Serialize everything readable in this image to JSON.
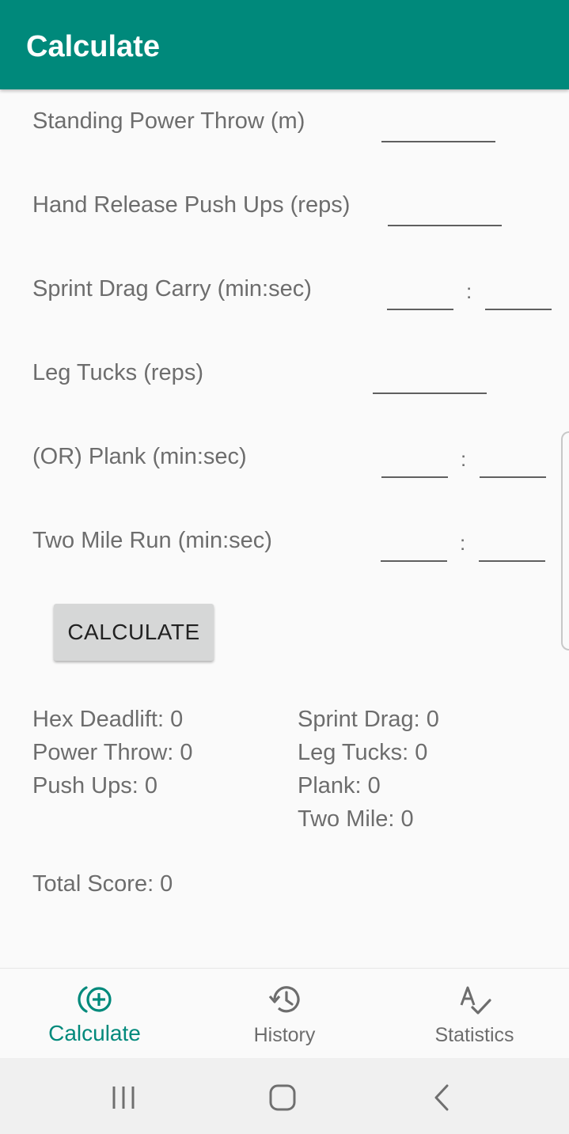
{
  "appbar": {
    "title": "Calculate"
  },
  "fields": [
    {
      "label": "Standing Power Throw (m)",
      "inputs": [
        ""
      ]
    },
    {
      "label": "Hand Release Push Ups (reps)",
      "inputs": [
        ""
      ]
    },
    {
      "label": "Sprint Drag Carry (min:sec)",
      "inputs": [
        "",
        ""
      ],
      "separator": ":"
    },
    {
      "label": "Leg Tucks (reps)",
      "inputs": [
        ""
      ]
    },
    {
      "label": "(OR) Plank (min:sec)",
      "inputs": [
        "",
        ""
      ],
      "separator": ":"
    },
    {
      "label": "Two Mile Run (min:sec)",
      "inputs": [
        "",
        ""
      ],
      "separator": ":"
    }
  ],
  "calculate_button": {
    "label": "CALCULATE"
  },
  "results": {
    "left": [
      "Hex Deadlift: 0",
      "Power Throw: 0",
      "Push Ups: 0"
    ],
    "right": [
      "Sprint Drag: 0",
      "Leg Tucks: 0",
      "Plank: 0",
      "Two Mile: 0"
    ],
    "total": "Total Score: 0"
  },
  "bottom_nav": {
    "items": [
      {
        "label": "Calculate",
        "icon": "calculate-add-icon",
        "active": true
      },
      {
        "label": "History",
        "icon": "history-icon",
        "active": false
      },
      {
        "label": "Statistics",
        "icon": "spellcheck-icon",
        "active": false
      }
    ],
    "active_color": "#00897b",
    "inactive_color": "#6d6d6d"
  },
  "system_nav": {
    "icons": [
      "recent-apps-icon",
      "home-icon",
      "back-icon"
    ]
  },
  "colors": {
    "primary": "#00897b",
    "background": "#fafafa",
    "text": "#6d6d6d"
  }
}
